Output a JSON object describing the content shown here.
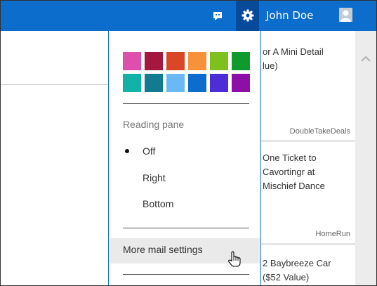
{
  "header": {
    "username": "John Doe",
    "icons": [
      "feedback-icon",
      "gear-icon",
      "avatar-icon"
    ],
    "bar_color": "#0c6dcc",
    "gear_active_color": "#064a99"
  },
  "settings_menu": {
    "theme_colors": [
      "#de4fad",
      "#a4173e",
      "#d94726",
      "#f7923b",
      "#7ec11c",
      "#0f9a2d",
      "#12b2a9",
      "#127b8f",
      "#6bb9f4",
      "#0c6dcc",
      "#4d2ed6",
      "#8e0fa7"
    ],
    "reading_pane": {
      "heading": "Reading pane",
      "options": [
        {
          "label": "Off",
          "selected": true
        },
        {
          "label": "Right",
          "selected": false
        },
        {
          "label": "Bottom",
          "selected": false
        }
      ]
    },
    "more_settings_label": "More mail settings"
  },
  "messages": [
    {
      "title": "or A Mini Detail\nlue)",
      "sender": "DoubleTakeDeals"
    },
    {
      "title": "One Ticket to\nCavortingr at\nMischief Dance",
      "sender": "HomeRun"
    },
    {
      "title": "2 Baybreeze Car\n($52 Value)",
      "sender": ""
    }
  ]
}
